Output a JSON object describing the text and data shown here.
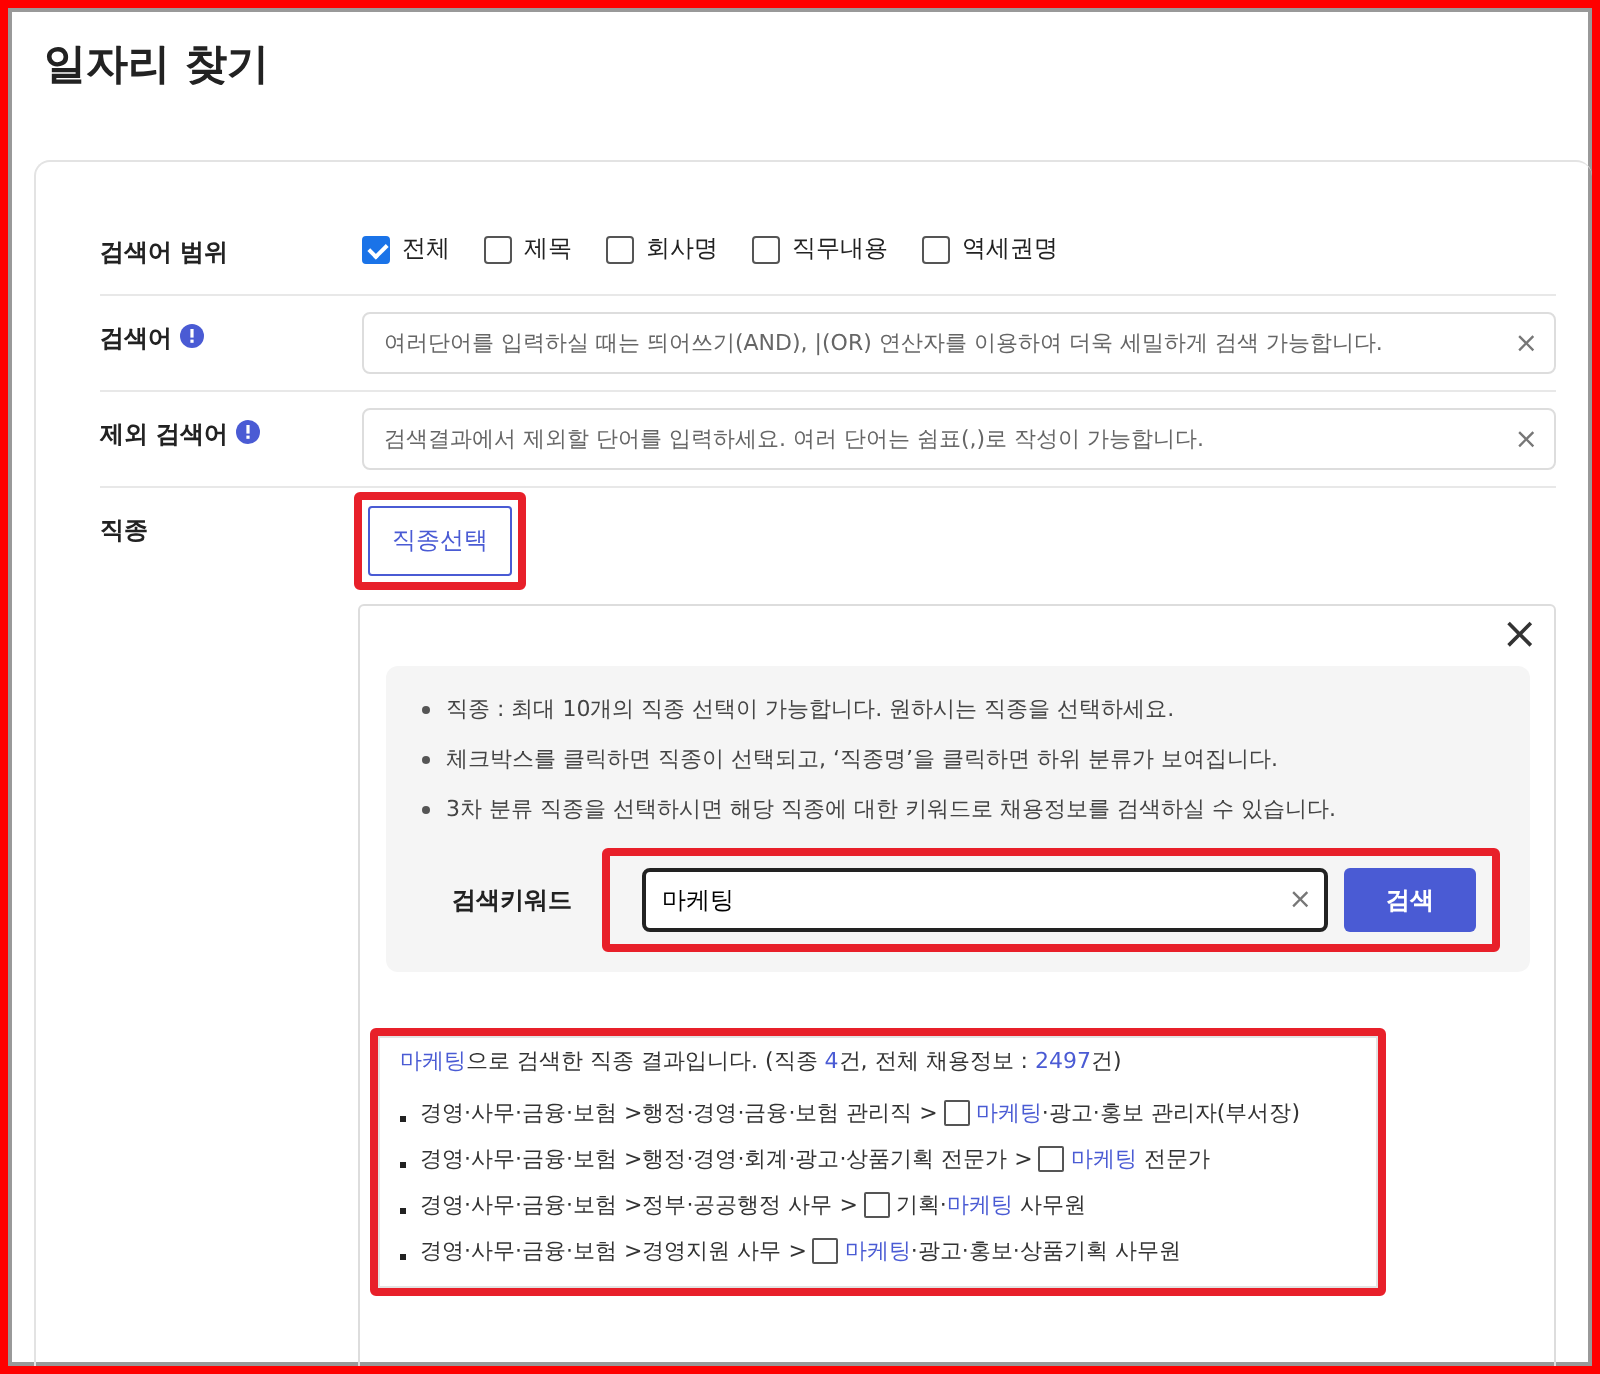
{
  "page_title": "일자리 찾기",
  "scope": {
    "label": "검색어 범위",
    "options": [
      {
        "label": "전체",
        "checked": true
      },
      {
        "label": "제목",
        "checked": false
      },
      {
        "label": "회사명",
        "checked": false
      },
      {
        "label": "직무내용",
        "checked": false
      },
      {
        "label": "역세권명",
        "checked": false
      }
    ]
  },
  "keyword": {
    "label": "검색어",
    "placeholder": "여러단어를 입력하실 때는 띄어쓰기(AND), |(OR) 연산자를 이용하여 더욱 세밀하게 검색 가능합니다.",
    "clear": "×"
  },
  "exclude": {
    "label": "제외 검색어",
    "placeholder": "검색결과에서 제외할 단어를 입력하세요. 여러 단어는 쉼표(,)로 작성이 가능합니다.",
    "clear": "×"
  },
  "job_type": {
    "label": "직종",
    "button": "직종선택",
    "highlighted": true
  },
  "picker": {
    "close": "×",
    "notes": [
      "직종 : 최대 10개의 직종 선택이 가능합니다. 원하시는 직종을 선택하세요.",
      "체크박스를 클릭하면 직종이 선택되고, ‘직종명’을 클릭하면 하위 분류가 보여집니다.",
      "3차 분류 직종을 선택하시면 해당 직종에 대한 키워드로 채용정보를 검색하실 수 있습니다."
    ],
    "search": {
      "label": "검색키워드",
      "value": "마케팅",
      "clear": "×",
      "button": "검색",
      "highlighted": true
    },
    "results": {
      "highlighted": true,
      "summary": [
        {
          "text": "마케팅",
          "highlight": true
        },
        {
          "text": "으로 검색한 직종 결과입니다. (직종 ",
          "highlight": false
        },
        {
          "text": "4",
          "highlight": true
        },
        {
          "text": "건, 전체 채용정보 : ",
          "highlight": false
        },
        {
          "text": "2497",
          "highlight": true
        },
        {
          "text": "건)",
          "highlight": false
        }
      ],
      "items": [
        {
          "path": "경영·사무·금융·보험 >행정·경영·금융·보험 관리직 >",
          "checked": false,
          "name": [
            {
              "text": "마케팅",
              "highlight": true
            },
            {
              "text": "·광고·홍보 관리자(부서장)",
              "highlight": false
            }
          ]
        },
        {
          "path": "경영·사무·금융·보험 >행정·경영·회계·광고·상품기획 전문가 >",
          "checked": false,
          "name": [
            {
              "text": "마케팅",
              "highlight": true
            },
            {
              "text": " 전문가",
              "highlight": false
            }
          ]
        },
        {
          "path": "경영·사무·금융·보험 >정부·공공행정 사무 >",
          "checked": false,
          "name": [
            {
              "text": "기획·",
              "highlight": false
            },
            {
              "text": "마케팅",
              "highlight": true
            },
            {
              "text": " 사무원",
              "highlight": false
            }
          ]
        },
        {
          "path": "경영·사무·금융·보험 >경영지원 사무 >",
          "checked": false,
          "name": [
            {
              "text": "마케팅",
              "highlight": true
            },
            {
              "text": "·광고·홍보·상품기획 사무원",
              "highlight": false
            }
          ]
        }
      ]
    }
  }
}
